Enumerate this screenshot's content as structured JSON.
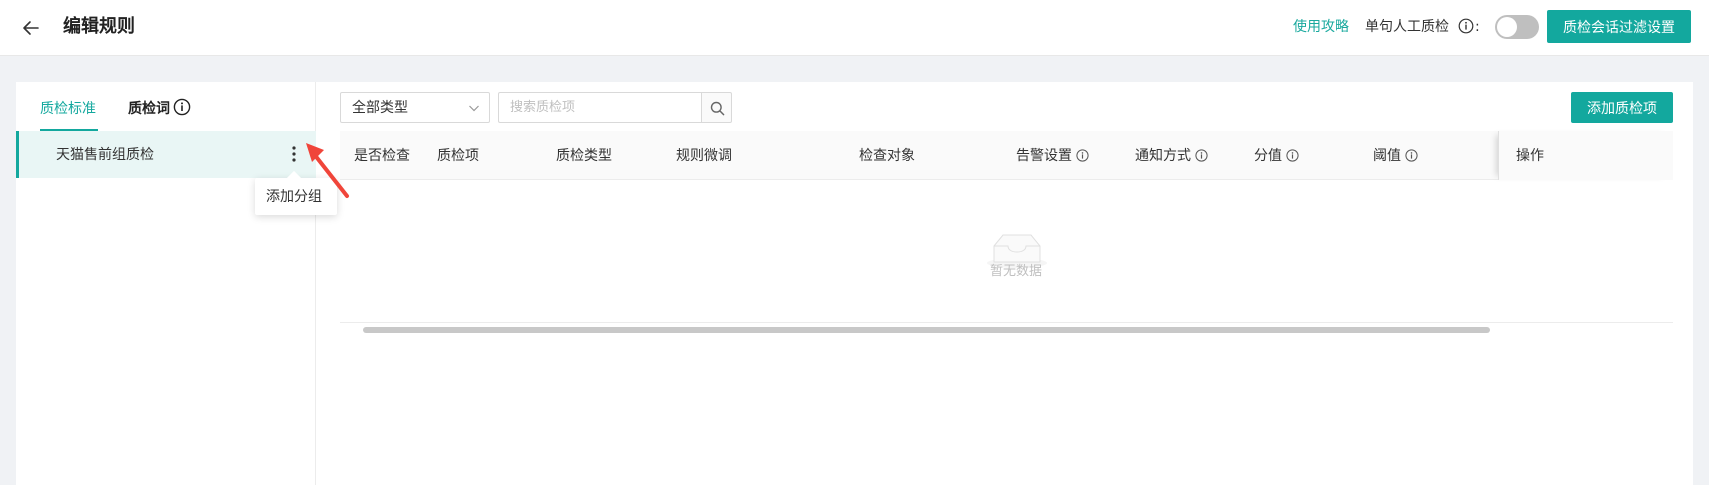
{
  "header": {
    "title": "编辑规则",
    "guide_link": "使用攻略",
    "manual_label": "单句人工质检",
    "colon": ":",
    "manual_enabled": false,
    "filter_button": "质检会话过滤设置"
  },
  "left": {
    "tabs": [
      {
        "label": "质检标准",
        "active": true
      },
      {
        "label": "质检词",
        "active": false
      }
    ],
    "groups": [
      {
        "label": "天猫售前组质检",
        "selected": true
      }
    ],
    "menu": {
      "add_group": "添加分组"
    }
  },
  "toolbar": {
    "type_select_value": "全部类型",
    "search_placeholder": "搜索质检项",
    "add_button": "添加质检项"
  },
  "table": {
    "columns": [
      "是否检查",
      "质检项",
      "质检类型",
      "规则微调",
      "检查对象",
      "告警设置",
      "通知方式",
      "分值",
      "阈值"
    ],
    "operation_column": "操作",
    "empty_text": "暂无数据"
  },
  "colors": {
    "accent": "#13a89e",
    "annotation": "#f0453a"
  }
}
